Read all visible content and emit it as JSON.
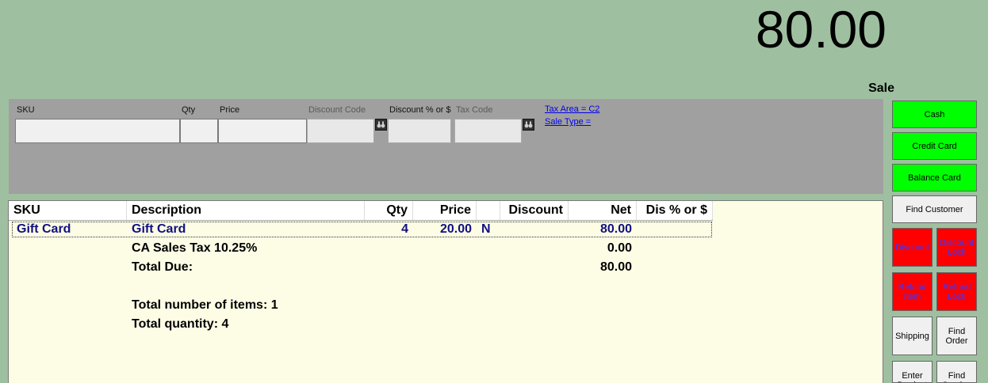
{
  "display": {
    "total": "80.00",
    "mode": "Sale"
  },
  "entry": {
    "sku_label": "SKU",
    "qty_label": "Qty",
    "price_label": "Price",
    "discount_code_label": "Discount Code",
    "discount_pct_label": "Discount % or $",
    "tax_code_label": "Tax Code",
    "tax_area_link": "Tax Area = C2",
    "sale_type_link": "Sale Type ="
  },
  "grid": {
    "columns": [
      "SKU",
      "Description",
      "Qty",
      "Price",
      "",
      "Discount",
      "Net",
      "Dis % or $"
    ],
    "rows": [
      {
        "sku": "Gift Card",
        "description": "Gift Card",
        "qty": "4",
        "price": "20.00",
        "flag": "N",
        "discount": "",
        "net": "80.00",
        "dis": ""
      }
    ],
    "tax": {
      "label": "CA Sales Tax 10.25%",
      "value": "0.00"
    },
    "total_due": {
      "label": "Total Due:",
      "value": "80.00"
    },
    "total_items": "Total number of items: 1",
    "total_quantity": "Total quantity: 4"
  },
  "buttons": {
    "cash": "Cash",
    "credit_card": "Credit Card",
    "balance_card": "Balance Card",
    "find_customer": "Find Customer",
    "discount": "Discount",
    "discount_lock": "Discount Lock",
    "refund_item": "Refund Item",
    "refund_lock": "Refund Lock",
    "shipping": "Shipping",
    "find_order": "Find Order",
    "enter_product": "Enter Product",
    "find_service": "Find Service"
  },
  "colors": {
    "background": "#9fc0a0",
    "pay_button": "#00ff00",
    "alert_button": "#ff0000",
    "row_text": "#101080"
  }
}
